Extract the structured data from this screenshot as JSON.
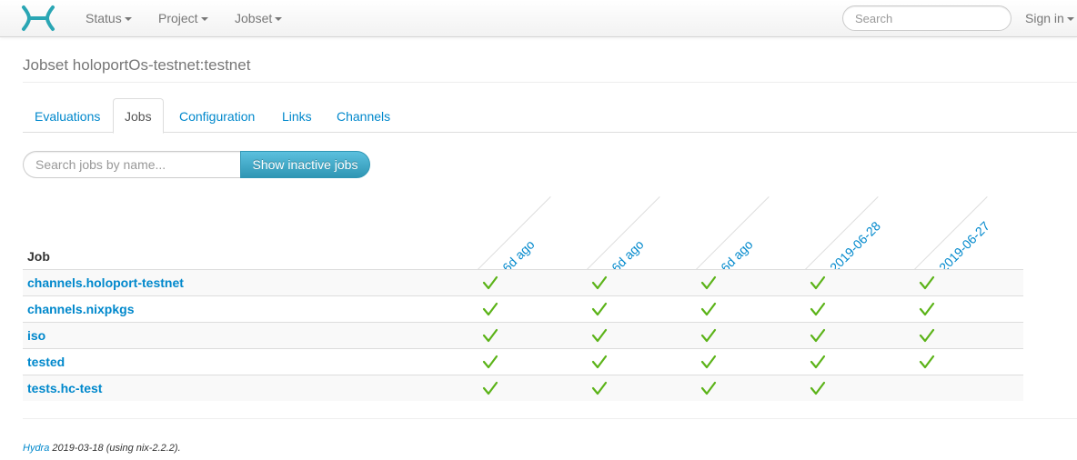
{
  "navbar": {
    "menus": [
      {
        "label": "Status"
      },
      {
        "label": "Project"
      },
      {
        "label": "Jobset"
      }
    ],
    "search_placeholder": "Search",
    "sign_in_label": "Sign in",
    "brand_color": "#2aa6b4"
  },
  "page": {
    "title": "Jobset holoportOs-testnet:testnet"
  },
  "tabs": [
    {
      "label": "Evaluations",
      "active": false
    },
    {
      "label": "Jobs",
      "active": true
    },
    {
      "label": "Configuration",
      "active": false
    },
    {
      "label": "Links",
      "active": false
    },
    {
      "label": "Channels",
      "active": false
    }
  ],
  "filter": {
    "placeholder": "Search jobs by name...",
    "button_label": "Show inactive jobs"
  },
  "jobs_table": {
    "job_column_header": "Job",
    "evaluations": [
      "6d ago",
      "6d ago",
      "6d ago",
      "2019-06-28",
      "2019-06-27"
    ],
    "rows": [
      {
        "job": "channels.holoport-testnet",
        "statuses": [
          "succeeded",
          "succeeded",
          "succeeded",
          "succeeded",
          "succeeded"
        ]
      },
      {
        "job": "channels.nixpkgs",
        "statuses": [
          "succeeded",
          "succeeded",
          "succeeded",
          "succeeded",
          "succeeded"
        ]
      },
      {
        "job": "iso",
        "statuses": [
          "succeeded",
          "succeeded",
          "succeeded",
          "succeeded",
          "succeeded"
        ]
      },
      {
        "job": "tested",
        "statuses": [
          "succeeded",
          "succeeded",
          "succeeded",
          "succeeded",
          "succeeded"
        ]
      },
      {
        "job": "tests.hc-test",
        "statuses": [
          "succeeded",
          "succeeded",
          "succeeded",
          "succeeded",
          ""
        ]
      }
    ],
    "success_color": "#5bb318"
  },
  "footer": {
    "link_label": "Hydra",
    "text": " 2019-03-18 (using nix-2.2.2)."
  }
}
